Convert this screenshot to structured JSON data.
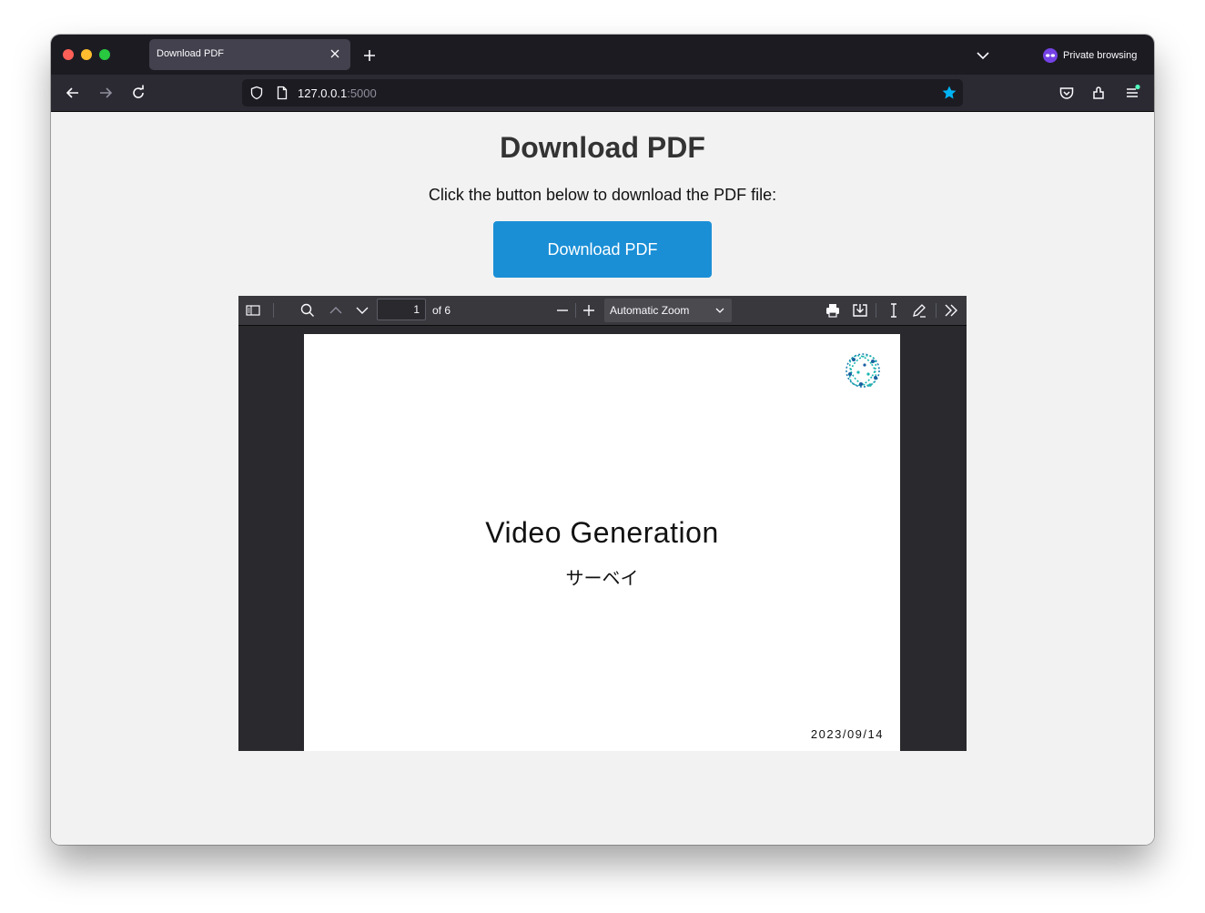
{
  "browser": {
    "tab_title": "Download PDF",
    "private_label": "Private browsing",
    "url_host": "127.0.0.1",
    "url_port": ":5000"
  },
  "page": {
    "heading": "Download PDF",
    "description": "Click the button below to download the PDF file:",
    "button_label": "Download PDF"
  },
  "pdf_viewer": {
    "page_number": "1",
    "page_count": "of 6",
    "zoom": "Automatic Zoom"
  },
  "pdf_page": {
    "title": "Video Generation",
    "subtitle": "サーベイ",
    "date": "2023/09/14"
  },
  "colors": {
    "button": "#1a8fd6",
    "titlebar": "#1c1b22",
    "bookmark_star": "#00b3f4"
  },
  "icons": [
    "close-icon",
    "plus-icon",
    "chevron-down-icon",
    "private-mask-icon",
    "back-arrow-icon",
    "forward-arrow-icon",
    "reload-icon",
    "shield-icon",
    "page-icon",
    "star-icon",
    "pocket-icon",
    "extensions-icon",
    "menu-icon",
    "sidebar-toggle-icon",
    "search-icon",
    "chevron-up-icon",
    "minus-icon",
    "print-icon",
    "save-icon",
    "text-cursor-icon",
    "pen-icon",
    "double-chevron-right-icon",
    "logo-icon"
  ]
}
